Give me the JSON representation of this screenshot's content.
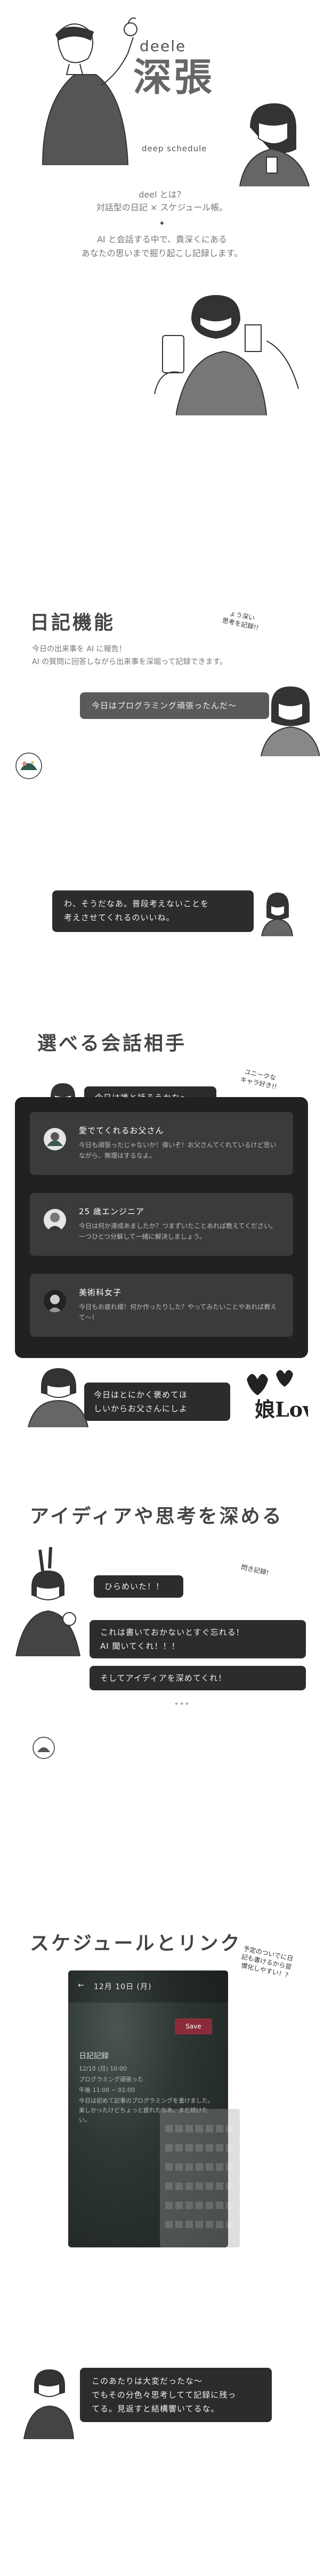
{
  "hero": {
    "brand_en": "deele",
    "brand_jp": "深張",
    "brand_sub": "deep schedule",
    "intro_question": "deel とは？",
    "intro_line1": "対話型の日記 × スケジュール帳。",
    "intro_line2": "AI と会話する中で、貴深くにある",
    "intro_line3": "あなたの思いまで掘り起こし記録します。"
  },
  "diary": {
    "title": "日記機能",
    "desc1": "今日の出来事を AI に報告！",
    "desc2": "AI の質問に回答しながら出来事を深堀って記録できます。",
    "note": "ょう深い\n思考を記録!!",
    "user_message": "今日はプログラミング頑張ったんだ～",
    "ai_reply_1": "わ、そうだなあ。普段考えないことを",
    "ai_reply_2": "考えさせてくれるのいいね。"
  },
  "partners": {
    "title": "選べる会話相手",
    "prompt": "今日は誰と話そうかな～",
    "note": "ユニークな\nキャラ好き!!",
    "items": [
      {
        "name": "愛でてくれるお父さん",
        "desc": "今日も頑張ったじゃないか！偉いぞ！お父さんてくれているけど思いながら、無理はするなよ。"
      },
      {
        "name": "25 歳エンジニア",
        "desc": "今日は何か達成あましたか？つまずいたことあれば教えてください。一つひとつ分解して一緒に解決しましょう。"
      },
      {
        "name": "美術科女子",
        "desc": "今日もお疲れ様！何か作ったりした？やってみたいことやあれば教えて～！"
      }
    ],
    "reply_1": "今日はとにかく褒めてほ",
    "reply_2": "しいからお父さんにしよ",
    "love_text": "娘Love"
  },
  "ideas": {
    "title": "アイディアや思考を深める",
    "note": "閃き記録!",
    "msg1": "ひらめいた！！",
    "msg2": "これは書いておかないとすぐ忘れる！",
    "msg3": "AI 聞いてくれ！！！",
    "msg4": "そしてアイディアを深めてくれ！"
  },
  "schedule": {
    "title": "スケジュールとリンク",
    "note": "予定のついでに日\n記も書けるから習\n慣化しやすい！?",
    "phone_date": "12月 10日 (月)",
    "save_label": "Save",
    "diary_heading": "日記記録",
    "diary_lines": [
      "12/10 (月) 10:00",
      "プログラミング頑張った",
      "午後 11:00 ~ 01:00",
      "今日は初めて記事のプログラミングを書けました。楽しかったけどちょっと疲れたなあ。まだ続けたい。"
    ],
    "reply_1": "このあたりは大変だったな～",
    "reply_2": "でもその分色々思考してて記録に残っ",
    "reply_3": "てる。見返すと結構響いてるな。"
  },
  "colors": {
    "bubble": "#2b2d2d",
    "panel": "#202222",
    "save": "#8b2b3a"
  }
}
